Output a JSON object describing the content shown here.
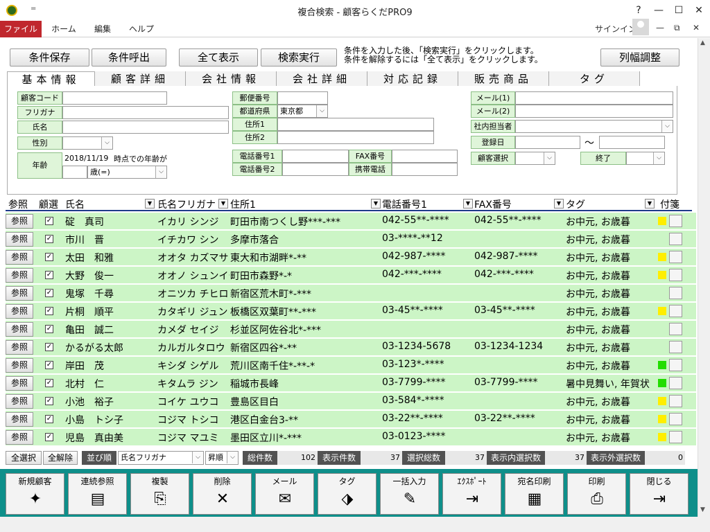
{
  "window": {
    "title": "複合検索 - 顧客らくだPRO9",
    "qat": "=",
    "help": "?",
    "min": "—",
    "max": "☐",
    "close": "✕"
  },
  "ribbon": {
    "tabs": [
      "ファイル",
      "ホーム",
      "編集",
      "ヘルプ"
    ],
    "signin": "サインイン",
    "min": "—",
    "restore": "⧉",
    "close": "✕"
  },
  "actions": {
    "save_cond": "条件保存",
    "load_cond": "条件呼出",
    "show_all": "全て表示",
    "search": "検索実行",
    "col_adjust": "列幅調整",
    "hint1": "条件を入力した後、「検索実行」をクリックします。",
    "hint2": "条件を解除するには「全て表示」をクリックします。"
  },
  "tabs": [
    "基本情報",
    "顧客詳細",
    "会社情報",
    "会社詳細",
    "対応記録",
    "販売商品",
    "タグ"
  ],
  "form": {
    "customer_code": "顧客コード",
    "furigana": "フリガナ",
    "name": "氏名",
    "gender": "性別",
    "age": "年齢",
    "age_date": "2018/11/19",
    "age_suffix": "時点での年齢が",
    "age_op": "歳(=)",
    "postal": "郵便番号",
    "pref": "都道府県",
    "pref_value": "東京都",
    "addr1": "住所1",
    "addr2": "住所2",
    "tel1": "電話番号1",
    "tel2": "電話番号2",
    "fax": "FAX番号",
    "mobile": "携帯電話",
    "mail1": "メール(1)",
    "mail2": "メール(2)",
    "staff": "社内担当者",
    "reg_date": "登録日",
    "tilde": "～",
    "cust_select": "顧客選択",
    "end": "終了"
  },
  "grid": {
    "headers": {
      "ref": "参照",
      "sel": "顧選",
      "name": "氏名",
      "kana": "氏名フリガナ",
      "addr": "住所1",
      "tel": "電話番号1",
      "fax": "FAX番号",
      "tag": "タグ",
      "note": "付箋"
    },
    "ref_label": "参照",
    "check": "✓",
    "rows": [
      {
        "name": "碇　真司",
        "kana": "イカリ シンジ",
        "addr": "町田市南つくし野***-***",
        "tel": "042-55**-****",
        "fax": "042-55**-****",
        "tag": "お中元, お歳暮",
        "note": "#ffee00"
      },
      {
        "name": "市川　晋",
        "kana": "イチカワ シン",
        "addr": "多摩市落合",
        "tel": "03-****-**12",
        "fax": "",
        "tag": "お中元, お歳暮",
        "note": ""
      },
      {
        "name": "太田　和雅",
        "kana": "オオタ カズマサ",
        "addr": "東大和市湖畔*-**",
        "tel": "042-987-****",
        "fax": "042-987-****",
        "tag": "お中元, お歳暮",
        "note": "#ffee00"
      },
      {
        "name": "大野　俊一",
        "kana": "オオノ シュンイチ",
        "addr": "町田市森野*-*",
        "tel": "042-***-****",
        "fax": "042-***-****",
        "tag": "お中元, お歳暮",
        "note": "#ffee00"
      },
      {
        "name": "鬼塚　千尋",
        "kana": "オニツカ チヒロ",
        "addr": "新宿区荒木町*-***",
        "tel": "",
        "fax": "",
        "tag": "お中元, お歳暮",
        "note": ""
      },
      {
        "name": "片桐　順平",
        "kana": "カタギリ ジュン",
        "addr": "板橋区双葉町**-***",
        "tel": "03-45**-****",
        "fax": "03-45**-****",
        "tag": "お中元, お歳暮",
        "note": "#ffee00"
      },
      {
        "name": "亀田　誠二",
        "kana": "カメダ セイジ",
        "addr": "杉並区阿佐谷北*-***",
        "tel": "",
        "fax": "",
        "tag": "お中元, お歳暮",
        "note": ""
      },
      {
        "name": "かるがる太郎",
        "kana": "カルガルタロウ",
        "addr": "新宿区四谷*-**",
        "tel": "03-1234-5678",
        "fax": "03-1234-1234",
        "tag": "お中元, お歳暮",
        "note": ""
      },
      {
        "name": "岸田　茂",
        "kana": "キシダ シゲル",
        "addr": "荒川区南千住*-**-*",
        "tel": "03-123*-****",
        "fax": "",
        "tag": "お中元, お歳暮",
        "note": "#22dd00"
      },
      {
        "name": "北村　仁",
        "kana": "キタムラ ジン",
        "addr": "稲城市長峰",
        "tel": "03-7799-****",
        "fax": "03-7799-****",
        "tag": "暑中見舞い, 年賀状",
        "note": "#22dd00"
      },
      {
        "name": "小池　裕子",
        "kana": "コイケ ユウコ",
        "addr": "豊島区目白",
        "tel": "03-584*-****",
        "fax": "",
        "tag": "お中元, お歳暮",
        "note": "#ffee00"
      },
      {
        "name": "小島　トシ子",
        "kana": "コジマ トシコ",
        "addr": "港区白金台3-**",
        "tel": "03-22**-****",
        "fax": "03-22**-****",
        "tag": "お中元, お歳暮",
        "note": "#ffee00"
      },
      {
        "name": "児島　真由美",
        "kana": "コジマ マユミ",
        "addr": "墨田区立川*-***",
        "tel": "03-0123-****",
        "fax": "",
        "tag": "お中元, お歳暮",
        "note": "#ffee00"
      }
    ]
  },
  "footer": {
    "select_all": "全選択",
    "clear_all": "全解除",
    "sort_by": "並び順",
    "sort_field": "氏名フリガナ",
    "sort_dir": "昇順",
    "total_label": "総件数",
    "total": "102",
    "shown_label": "表示件数",
    "shown": "37",
    "sel_total_label": "選択総数",
    "sel_total": "37",
    "sel_in_label": "表示内選択数",
    "sel_in": "37",
    "sel_out_label": "表示外選択数",
    "sel_out": "0"
  },
  "toolbar": [
    {
      "label": "新規顧客",
      "icon": "new-customer-icon",
      "glyph": "✦"
    },
    {
      "label": "連続参照",
      "icon": "continuous-view-icon",
      "glyph": "▤"
    },
    {
      "label": "複製",
      "icon": "duplicate-icon",
      "glyph": "⎘"
    },
    {
      "label": "削除",
      "icon": "delete-icon",
      "glyph": "✕"
    },
    {
      "label": "メール",
      "icon": "mail-icon",
      "glyph": "✉"
    },
    {
      "label": "タグ",
      "icon": "tag-icon",
      "glyph": "⬗"
    },
    {
      "label": "一括入力",
      "icon": "bulk-input-icon",
      "glyph": "✎"
    },
    {
      "label": "ｴｸｽﾎﾟｰﾄ",
      "icon": "export-icon",
      "glyph": "⇥"
    },
    {
      "label": "宛名印刷",
      "icon": "address-print-icon",
      "glyph": "▦"
    },
    {
      "label": "印刷",
      "icon": "print-icon",
      "glyph": "⎙"
    },
    {
      "label": "閉じる",
      "icon": "close-door-icon",
      "glyph": "⇥"
    }
  ],
  "colors": {
    "accent": "#c0272d",
    "row_bg": "#ccf5c6",
    "toolbar_bg": "#0e8f8a",
    "label_bg": "#dff5d9"
  }
}
